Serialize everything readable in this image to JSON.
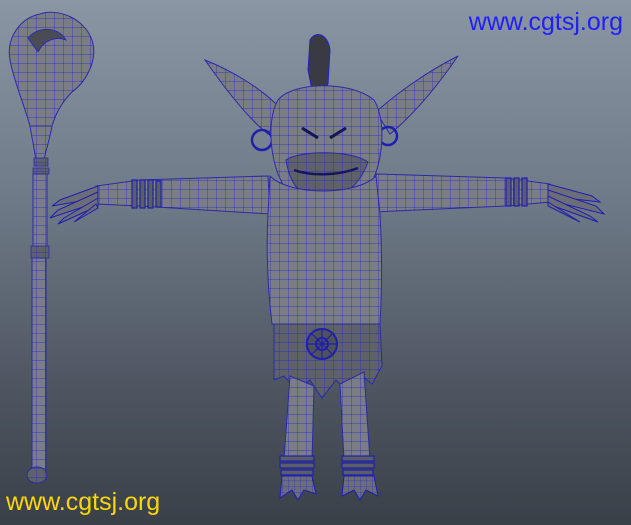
{
  "watermarks": {
    "top_right": "www.cgtsj.org",
    "bottom_left": "www.cgtsj.org"
  },
  "colors": {
    "background_top": "#8a96a4",
    "background_bottom": "#3a4048",
    "mesh_fill": "#7b7d86",
    "mesh_shadow": "#5c5e67",
    "wireframe": "#1e1ec8",
    "dark_accent": "#2a2a2f",
    "watermark_top": "#2020ff",
    "watermark_bottom": "#ffd700"
  },
  "viewport": {
    "shading_mode": "wireframe-on-shaded",
    "objects": [
      "goblin-character",
      "staff"
    ]
  }
}
